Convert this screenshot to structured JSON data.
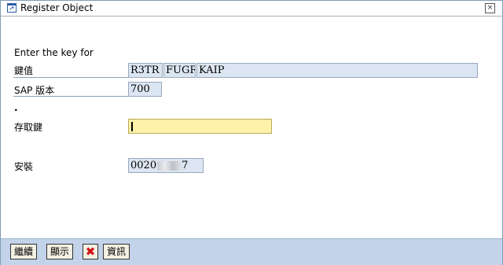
{
  "window": {
    "title": "Register Object",
    "close_glyph": "×"
  },
  "form": {
    "header": "Enter the key for",
    "key_label": "鍵值",
    "key_parts": [
      "R3TR",
      "FUGR",
      "KAIP"
    ],
    "version_label": "SAP 版本",
    "version_value": "700",
    "dot": "·",
    "access_key_label": "存取鍵",
    "access_key_value": "",
    "install_label": "安裝",
    "install_prefix": "0020",
    "install_suffix": "7"
  },
  "footer": {
    "continue_label": "繼續",
    "display_label": "顯示",
    "cancel_glyph": "✖",
    "info_label": "資訊"
  },
  "colors": {
    "field_bg": "#dce6f2",
    "input_bg": "#fff2a8",
    "footer_bg": "#c2d3ea",
    "cancel_red": "#d01010"
  }
}
